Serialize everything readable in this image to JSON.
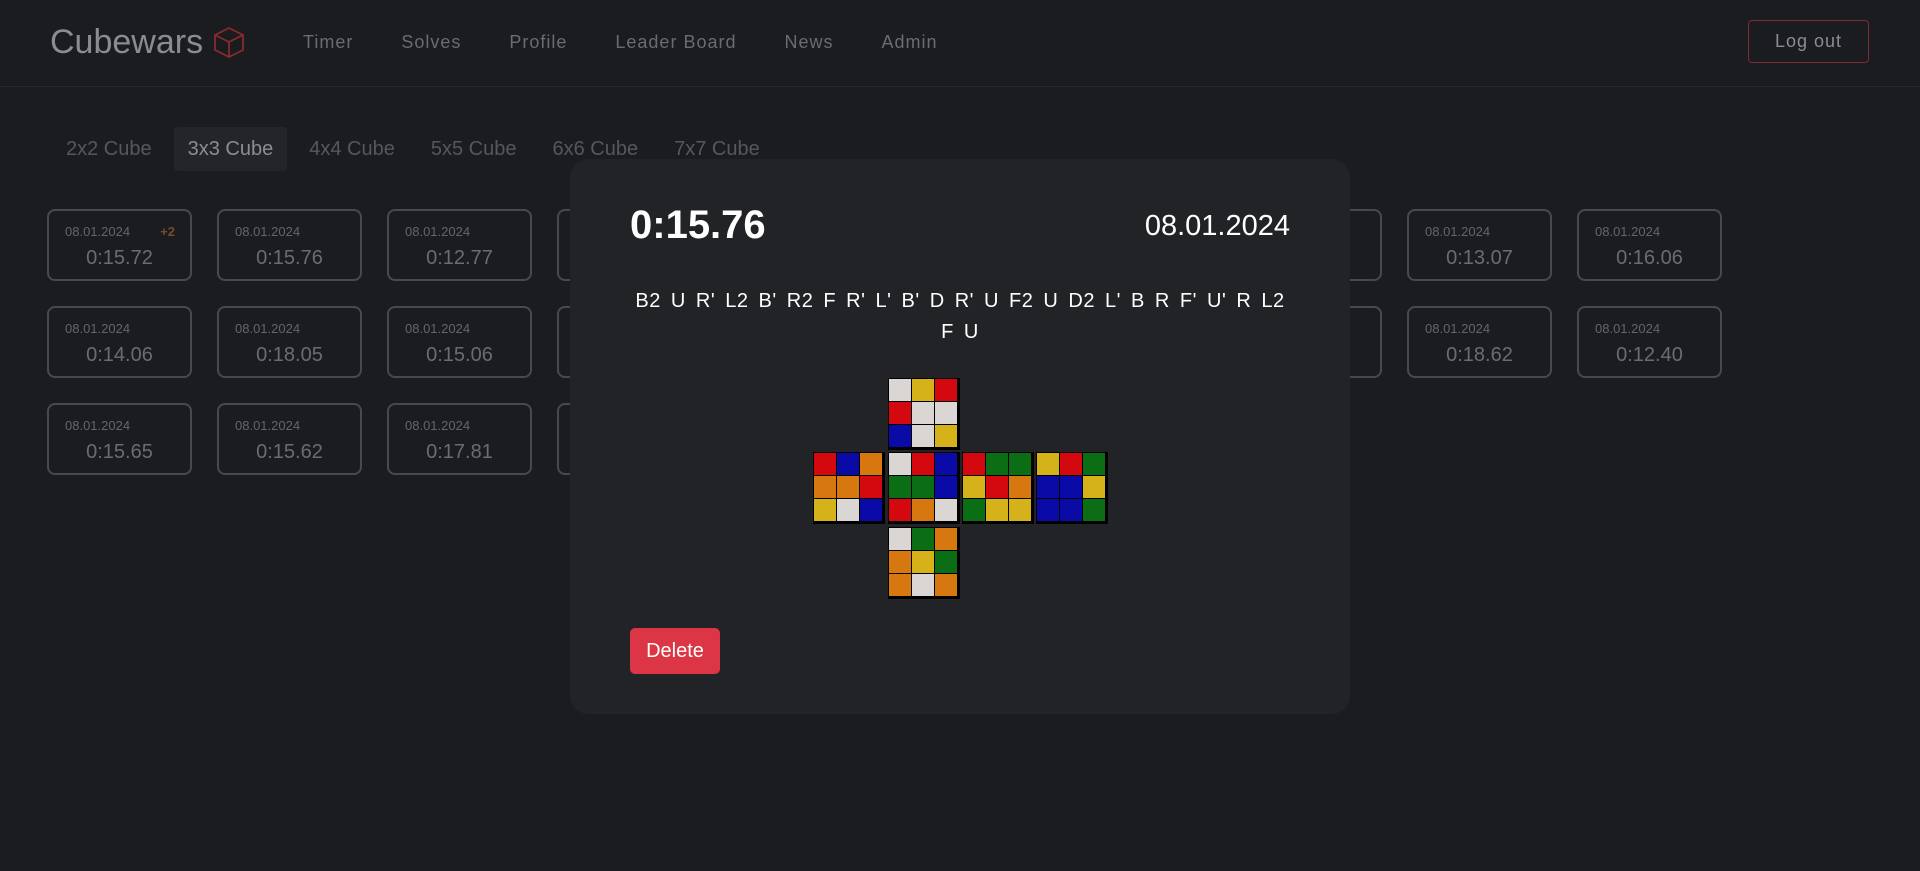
{
  "header": {
    "brand": "Cubewars",
    "nav": [
      "Timer",
      "Solves",
      "Profile",
      "Leader Board",
      "News",
      "Admin"
    ],
    "logout_label": "Log out"
  },
  "tabs": {
    "items": [
      "2x2 Cube",
      "3x3 Cube",
      "4x4 Cube",
      "5x5 Cube",
      "6x6 Cube",
      "7x7 Cube"
    ],
    "active": "3x3 Cube"
  },
  "solves": [
    {
      "date": "08.01.2024",
      "time": "0:15.72",
      "penalty": "+2"
    },
    {
      "date": "08.01.2024",
      "time": "0:15.76"
    },
    {
      "date": "08.01.2024",
      "time": "0:12.77"
    },
    {
      "date": "08.01.2024",
      "time": "0:13.07"
    },
    {
      "date": "08.01.2024",
      "time": "0:16.06"
    },
    {
      "date": "08.01.2024",
      "time": "0:14.06"
    },
    {
      "date": "08.01.2024",
      "time": "0:18.05"
    },
    {
      "date": "08.01.2024",
      "time": "0:15.06"
    },
    {
      "date": "08.01.2024",
      "time": "0:18.62"
    },
    {
      "date": "08.01.2024",
      "time": "0:12.40"
    },
    {
      "date": "08.01.2024",
      "time": "0:15.65"
    },
    {
      "date": "08.01.2024",
      "time": "0:15.62"
    },
    {
      "date": "08.01.2024",
      "time": "0:17.81"
    }
  ],
  "modal": {
    "time": "0:15.76",
    "date": "08.01.2024",
    "scramble": "B2 U R' L2 B' R2 F R' L' B' D R' U F2 U D2 L' B R F' U' R L2 F U",
    "delete_label": "Delete",
    "cube": {
      "colors": {
        "W": "#d9d6d3",
        "Y": "#d6b21a",
        "R": "#d4080f",
        "O": "#d6780f",
        "G": "#0b6e14",
        "B": "#0a0aa6"
      },
      "faces": {
        "U": [
          "W",
          "Y",
          "R",
          "R",
          "W",
          "W",
          "B",
          "W",
          "Y"
        ],
        "L": [
          "R",
          "B",
          "O",
          "O",
          "O",
          "R",
          "Y",
          "W",
          "B"
        ],
        "F": [
          "W",
          "R",
          "B",
          "G",
          "G",
          "B",
          "R",
          "O",
          "W"
        ],
        "R": [
          "R",
          "G",
          "G",
          "Y",
          "R",
          "O",
          "G",
          "Y",
          "Y"
        ],
        "B": [
          "Y",
          "R",
          "G",
          "B",
          "B",
          "Y",
          "B",
          "B",
          "G"
        ],
        "D": [
          "W",
          "G",
          "O",
          "O",
          "Y",
          "G",
          "O",
          "W",
          "O"
        ]
      }
    }
  }
}
